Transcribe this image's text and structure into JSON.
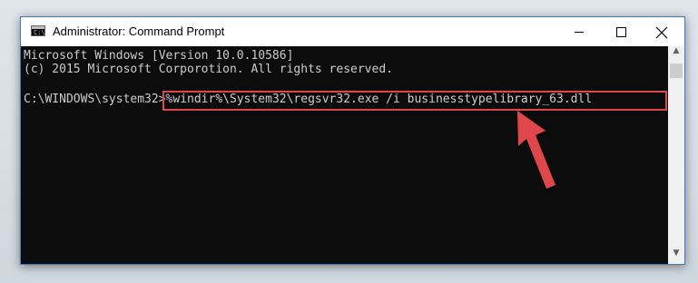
{
  "window": {
    "title": "Administrator: Command Prompt",
    "icon": "cmd-icon",
    "controls": {
      "minimize": "minimize-icon",
      "maximize": "maximize-icon",
      "close": "close-icon"
    }
  },
  "app_icon_text": "C:\\",
  "console": {
    "lines": [
      "Microsoft Windows [Version 10.0.10586]",
      "(c) 2015 Microsoft Corporotion. All rights reserved."
    ],
    "prompt": "C:\\WINDOWS\\system32>",
    "command": "%windir%\\System32\\regsvr32.exe /i businesstypelibrary_63.dll"
  },
  "scrollbar": {
    "up": "▲",
    "down": "▼"
  },
  "colors": {
    "console_bg": "#0c0c0c",
    "console_text": "#cccccc",
    "highlight_border": "#e0474c",
    "arrow": "#e0474c"
  }
}
